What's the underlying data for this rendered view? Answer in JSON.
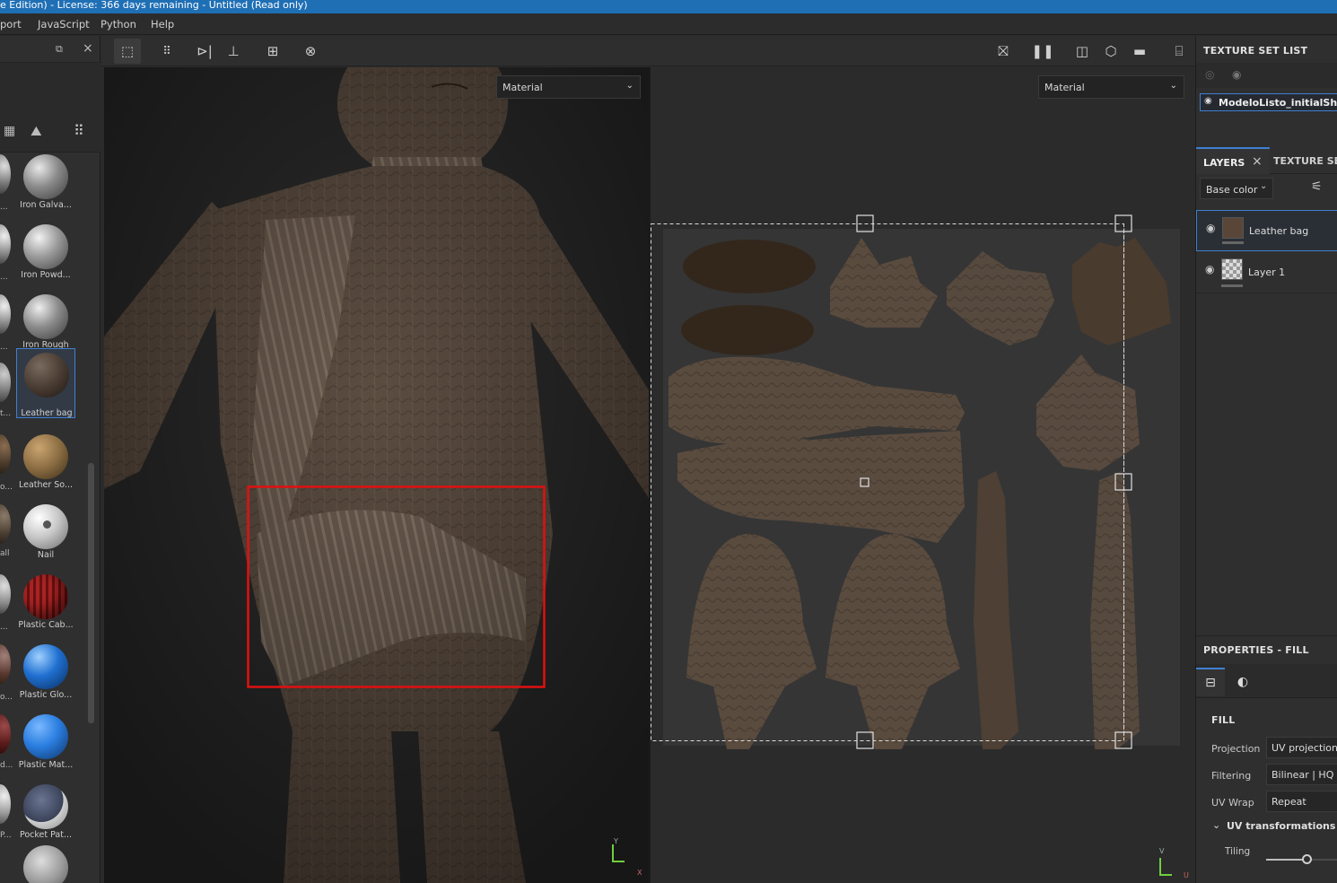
{
  "window": {
    "title": "e Edition) - License: 366 days remaining - Untitled (Read only)"
  },
  "menu": {
    "items": [
      "port",
      "JavaScript",
      "Python",
      "Help"
    ]
  },
  "shelf": {
    "materials": [
      {
        "label": "Iron Galva...",
        "color": "#8a8a8a"
      },
      {
        "label": "Iron Powd...",
        "color": "#9a9a9a"
      },
      {
        "label": "Iron Rough",
        "color": "#8c8c8c"
      },
      {
        "label": "Leather bag",
        "color": "#4a3d33",
        "selected": true
      },
      {
        "label": "Leather So...",
        "color": "#8a6c42"
      },
      {
        "label": "Nail",
        "color": "#c8c8c8"
      },
      {
        "label": "Plastic Cab...",
        "color": "#8c1c1c"
      },
      {
        "label": "Plastic Glo...",
        "color": "#1f6fd0"
      },
      {
        "label": "Plastic Mat...",
        "color": "#2a7ee0"
      },
      {
        "label": "Pocket Pat...",
        "color": "#3a4258"
      }
    ],
    "left_cut_labels": [
      "...",
      "...",
      "...",
      "t...",
      "o...",
      "all",
      "...",
      "o...",
      "d...",
      "P..."
    ]
  },
  "viewport3d": {
    "channel": "Material"
  },
  "viewport2d": {
    "channel": "Material"
  },
  "texture_set_list": {
    "title": "TEXTURE SET LIST",
    "item": "ModeloListo_initialShad"
  },
  "layers_panel": {
    "tab_layers": "LAYERS",
    "tab_texture_set": "TEXTURE SET",
    "channel": "Base color",
    "layers": [
      {
        "name": "Leather bag",
        "selected": true
      },
      {
        "name": "Layer 1",
        "selected": false
      }
    ]
  },
  "properties": {
    "title": "PROPERTIES - FILL",
    "section": "FILL",
    "rows": [
      {
        "label": "Projection",
        "value": "UV projection"
      },
      {
        "label": "Filtering",
        "value": "Bilinear | HQ"
      },
      {
        "label": "UV Wrap",
        "value": "Repeat"
      }
    ],
    "uv_transform": "UV transformations",
    "tiling_label": "Tiling",
    "tiling_value": 0.75
  },
  "axes": {
    "y": "Y",
    "x": "X",
    "u": "U",
    "v": "V"
  },
  "colors": {
    "accent": "#1f6fb5",
    "selection": "#3f7fd1",
    "highlight_box": "#e01010",
    "skin": "#5c4d41"
  }
}
